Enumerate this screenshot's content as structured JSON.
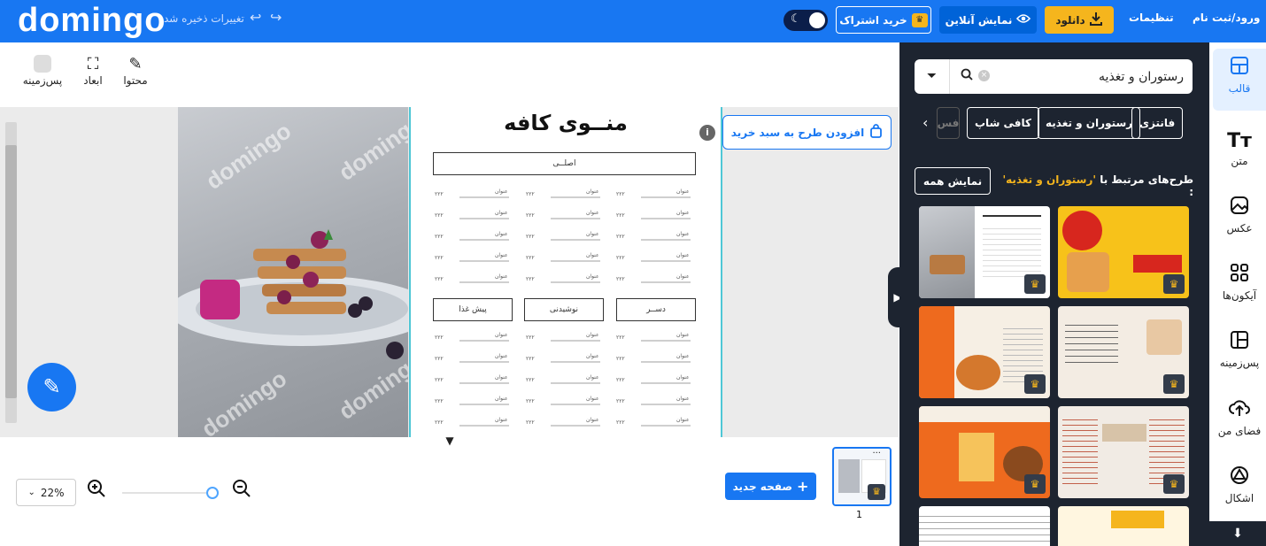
{
  "header": {
    "logo": "domingo",
    "save_status": "تغییرات ذخیره شد",
    "subscription_label": "خرید اشتراک",
    "preview_label": "نمایش آنلاین",
    "download_label": "دانلود",
    "settings_label": "تنظیمات",
    "login_label": "ورود/ثبت نام"
  },
  "toolbar": {
    "content_label": "محتوا",
    "dimensions_label": "ابعاد",
    "background_label": "پس‌زمینه"
  },
  "canvas": {
    "watermark": "domingo",
    "menu_title": "منــوی کافه",
    "section_main": "اصلــی",
    "section_dessert": "دســر",
    "section_drinks": "نوشیدنی",
    "section_appetizer": "پیش غذا",
    "item_label": "عنوان",
    "item_price": "۲۲۲",
    "add_to_cart_label": "افزودن طرح به سبد خرید",
    "info_glyph": "i"
  },
  "bottom": {
    "zoom_value": "22%",
    "new_page_label": "صفحه جدید",
    "page_number": "1"
  },
  "panel": {
    "search_value": "رستوران و تغذیه",
    "chips": [
      "فانتزی",
      "رستوران و تغذیه",
      "کافی شاپ",
      "فس"
    ],
    "related_prefix": "طرح‌های مرتبط با",
    "related_keyword": "'رستوران و تغذیه'",
    "related_suffix": ":",
    "show_all_label": "نمایش همه"
  },
  "nav": {
    "items": [
      {
        "label": "قالب",
        "icon": "template-icon"
      },
      {
        "label": "متن",
        "icon": "text-icon"
      },
      {
        "label": "عکس",
        "icon": "image-icon"
      },
      {
        "label": "آیکون‌ها",
        "icon": "icons-grid-icon"
      },
      {
        "label": "پس‌زمینه",
        "icon": "background-icon"
      },
      {
        "label": "فضای من",
        "icon": "cloud-upload-icon"
      },
      {
        "label": "اشکال",
        "icon": "shapes-icon"
      }
    ]
  },
  "colors": {
    "brand_blue": "#1877f2",
    "accent_yellow": "#f5b51d",
    "panel_dark": "#1d2430"
  }
}
